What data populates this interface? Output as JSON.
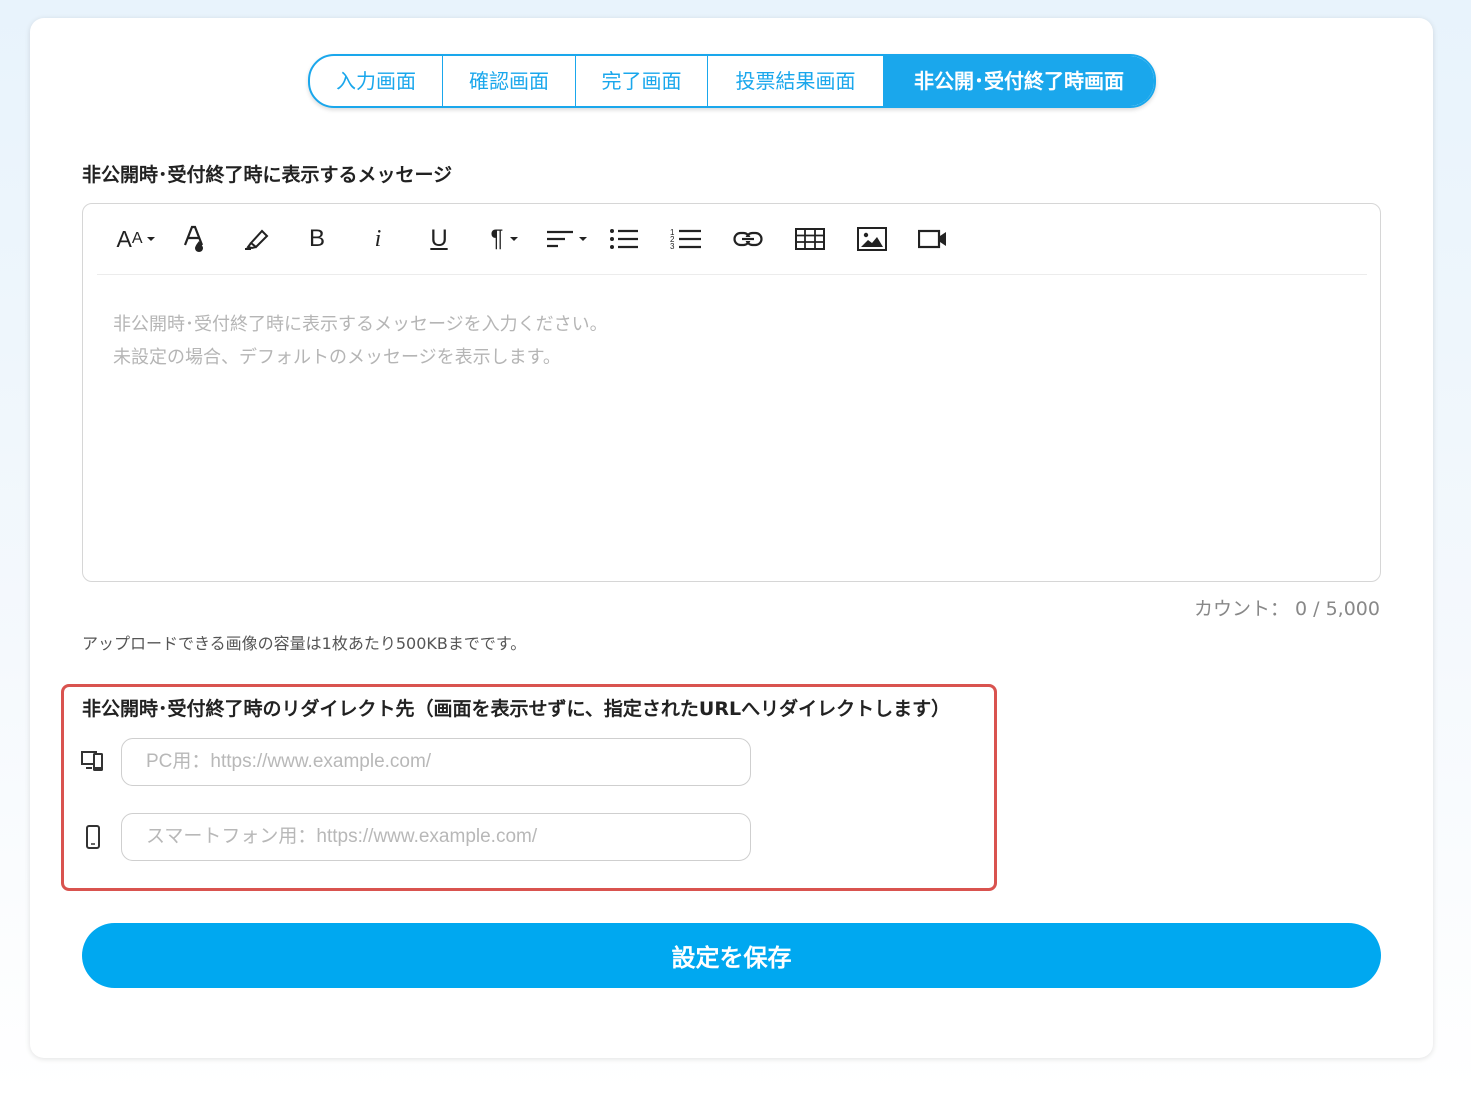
{
  "tabs": [
    {
      "label": "入力画面",
      "active": false
    },
    {
      "label": "確認画面",
      "active": false
    },
    {
      "label": "完了画面",
      "active": false
    },
    {
      "label": "投票結果画面",
      "active": false
    },
    {
      "label": "非公開･受付終了時画面",
      "active": true
    }
  ],
  "message_section": {
    "label": "非公開時･受付終了時に表示するメッセージ",
    "placeholder_line1": "非公開時･受付終了時に表示するメッセージを入力ください。",
    "placeholder_line2": "未設定の場合、デフォルトのメッセージを表示します。",
    "toolbar": {
      "font_size": "AA",
      "bold": "B",
      "italic": "i",
      "underline": "U",
      "paragraph": "¶"
    }
  },
  "counter": "カウント： 0 / 5,000",
  "upload_note": "アップロードできる画像の容量は1枚あたり500KBまでです。",
  "redirect": {
    "label": "非公開時･受付終了時のリダイレクト先（画面を表示せずに、指定されたURLへリダイレクトします）",
    "pc_placeholder": "PC用：https://www.example.com/",
    "sp_placeholder": "スマートフォン用：https://www.example.com/"
  },
  "save_button": "設定を保存",
  "colors": {
    "accent": "#00a8f0",
    "tab_border": "#1aa7ec",
    "highlight_border": "#d9534f"
  },
  "icons": [
    "font-size-icon",
    "text-color-icon",
    "highlighter-icon",
    "bold-icon",
    "italic-icon",
    "underline-icon",
    "paragraph-icon",
    "align-icon",
    "bullet-list-icon",
    "numbered-list-icon",
    "link-icon",
    "table-icon",
    "image-icon",
    "video-icon",
    "desktop-mobile-icon",
    "smartphone-icon"
  ]
}
